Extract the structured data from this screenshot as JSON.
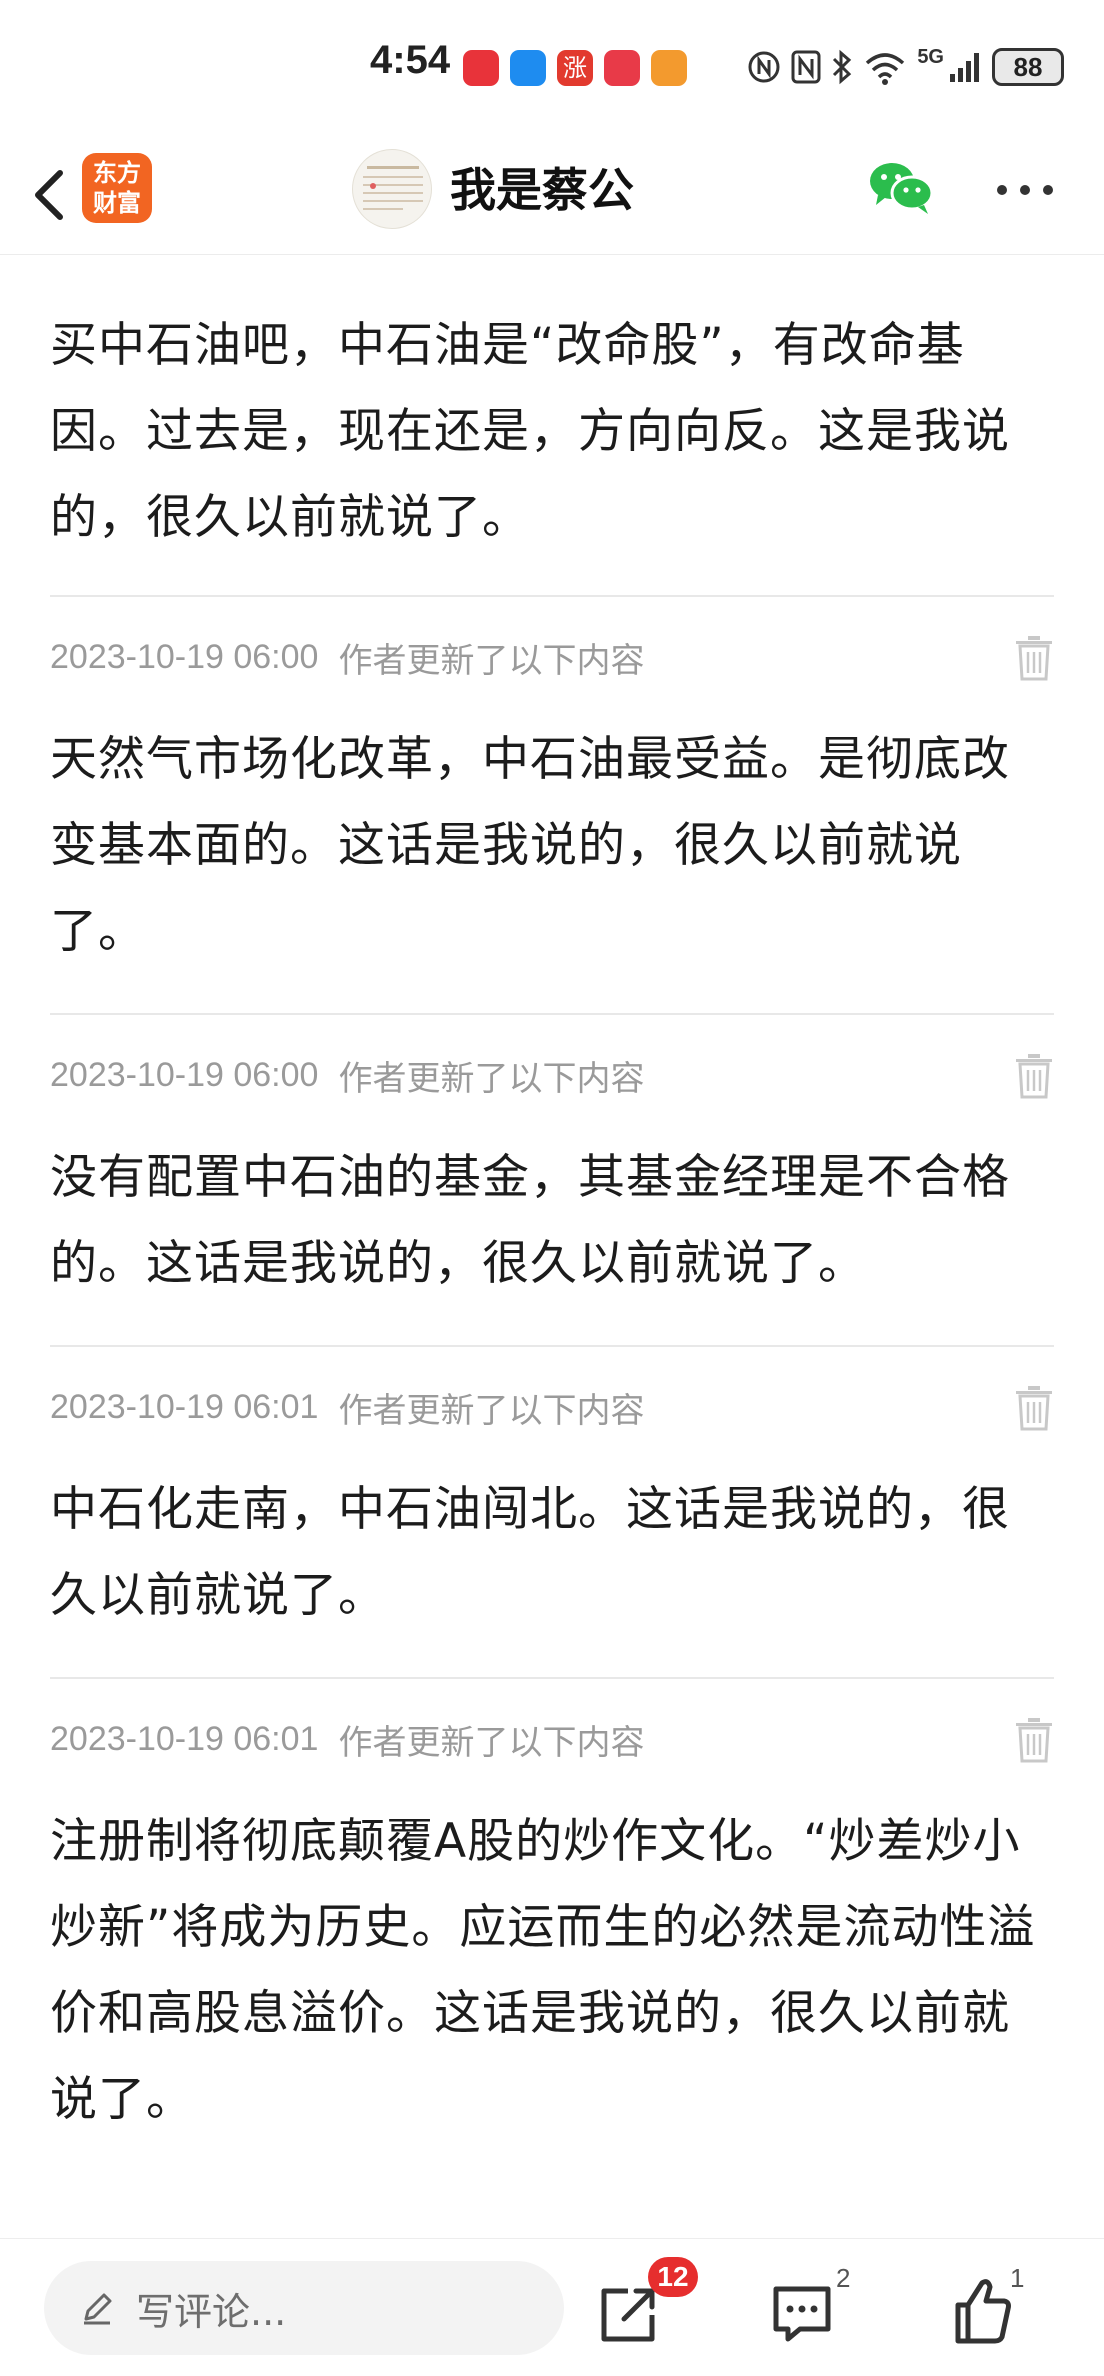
{
  "status_bar": {
    "time": "4:54",
    "network": "5G",
    "battery": "88",
    "app_icons": [
      {
        "name": "red-app-icon",
        "color": "#e8333a"
      },
      {
        "name": "message-app-icon",
        "color": "#1e8cf0"
      },
      {
        "name": "stock-app-icon",
        "color": "#e23a2e",
        "glyph": "涨"
      },
      {
        "name": "huawei-app-icon",
        "color": "#e83a48"
      },
      {
        "name": "orange-app-icon",
        "color": "#f39a2e"
      }
    ]
  },
  "nav": {
    "logo_line1": "东方",
    "logo_line2": "财富",
    "title": "我是蔡公",
    "brand_color": "#f26522",
    "wechat_color": "#2bbd4d"
  },
  "first_post": {
    "text": "买中石油吧，中石油是“改命股”，有改命基因。过去是，现在还是，方向向反。这是我说的，很久以前就说了。"
  },
  "updates": [
    {
      "time": "2023-10-19 06:00",
      "note": "作者更新了以下内容",
      "text": "天然气市场化改革，中石油最受益。是彻底改变基本面的。这话是我说的，很久以前就说了。"
    },
    {
      "time": "2023-10-19 06:00",
      "note": "作者更新了以下内容",
      "text": "没有配置中石油的基金，其基金经理是不合格的。这话是我说的，很久以前就说了。"
    },
    {
      "time": "2023-10-19 06:01",
      "note": "作者更新了以下内容",
      "text": "中石化走南，中石油闯北。这话是我说的，很久以前就说了。"
    },
    {
      "time": "2023-10-19 06:01",
      "note": "作者更新了以下内容",
      "text": "注册制将彻底颠覆A股的炒作文化。“炒差炒小炒新”将成为历史。应运而生的必然是流动性溢价和高股息溢价。这话是我说的，很久以前就说了。"
    }
  ],
  "bottom_bar": {
    "comment_placeholder": "写评论...",
    "share_count": "12",
    "comment_count": "2",
    "like_count": "1"
  }
}
